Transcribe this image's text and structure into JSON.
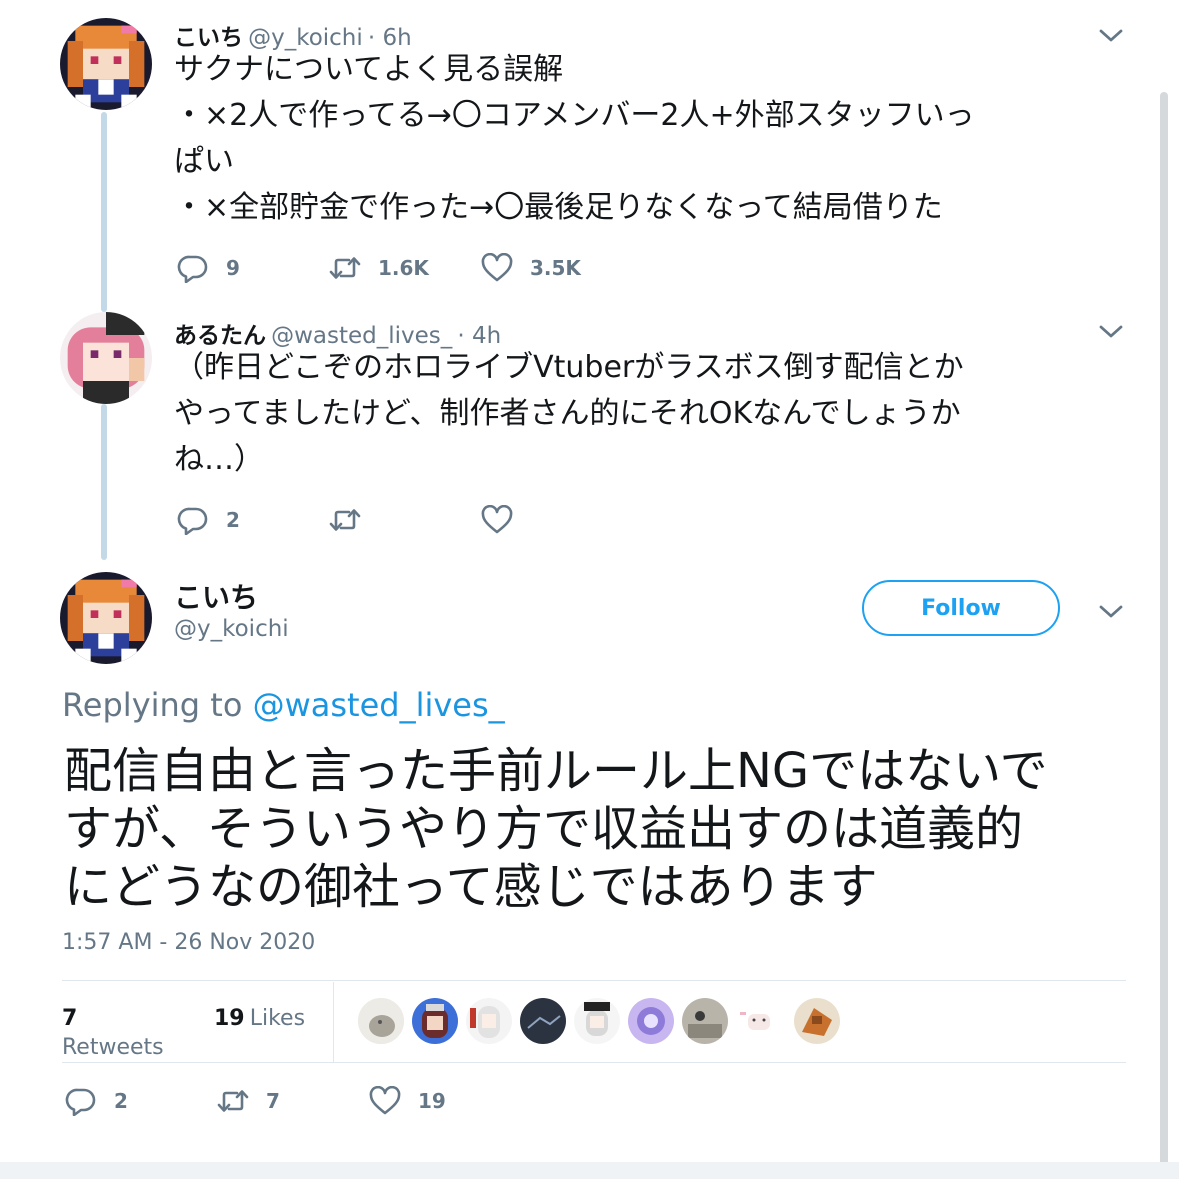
{
  "thread": [
    {
      "name": "こいち",
      "handle": "@y_koichi",
      "time": "· 6h",
      "lines": [
        "サクナについてよく見る誤解",
        "・×2人で作ってる→〇コアメンバー2人+外部スタッフいっ",
        "ぱい",
        "・×全部貯金で作った→〇最後足りなくなって結局借りた"
      ],
      "replies": "9",
      "retweets": "1.6K",
      "likes": "3.5K"
    },
    {
      "name": "あるたん",
      "handle": "@wasted_lives_",
      "time": "· 4h",
      "lines": [
        "（昨日どこぞのホロライブVtuberがラスボス倒す配信とか",
        "やってましたけど、制作者さん的にそれOKなんでしょうか",
        "ね…）"
      ],
      "replies": "2",
      "retweets": "",
      "likes": ""
    }
  ],
  "main_tweet": {
    "name": "こいち",
    "handle": "@y_koichi",
    "follow_label": "Follow",
    "replying_prefix": "Replying to",
    "replying_to": "@wasted_lives_",
    "lines": [
      "配信自由と言った手前ルール上NGではないで",
      "すが、そういうやり方で収益出すのは道義的",
      "にどうなの御社って感じではあります"
    ],
    "timestamp": "1:57 AM - 26 Nov 2020",
    "retweets_count": "7",
    "retweets_label": "Retweets",
    "likes_count": "19",
    "likes_label": "Likes",
    "reply_count": "2",
    "retweet_count": "7",
    "like_count": "19"
  },
  "colors": {
    "accent": "#1da1f2",
    "secondary_text": "#657786",
    "thread_line": "#c4d9e8"
  },
  "icons": [
    "reply-icon",
    "retweet-icon",
    "heart-icon",
    "chevron-down-icon"
  ]
}
